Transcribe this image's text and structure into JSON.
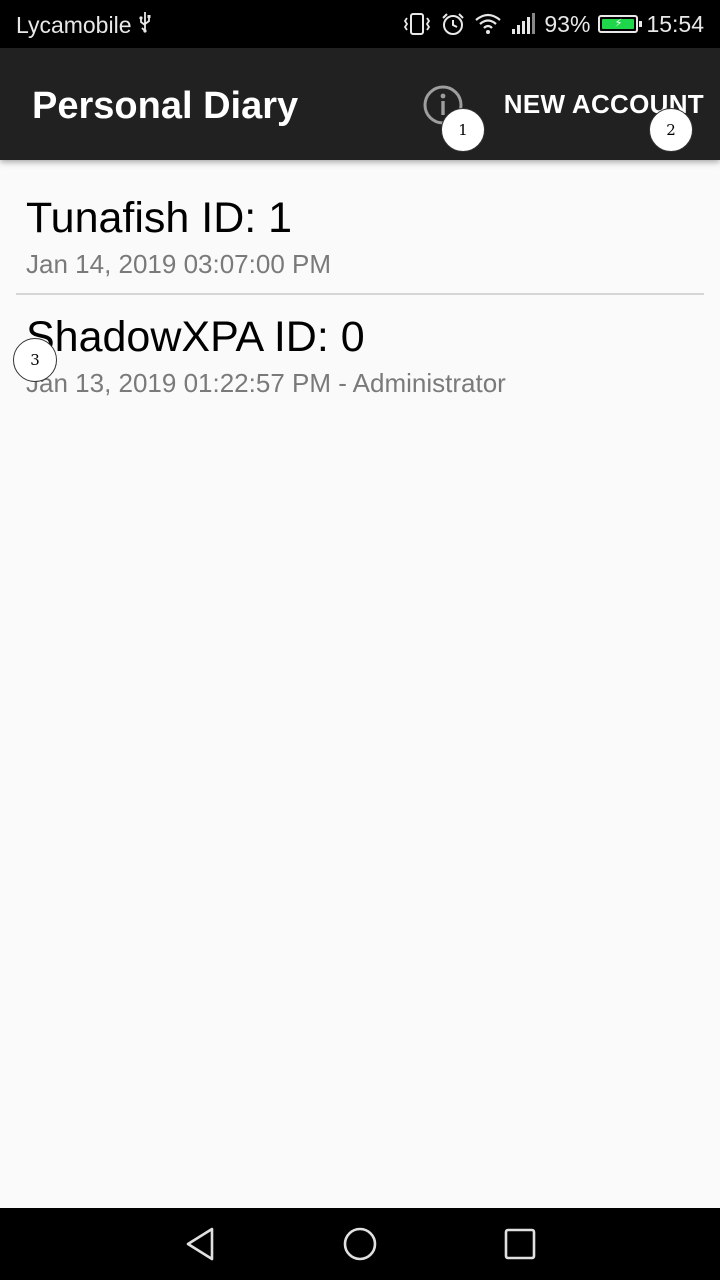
{
  "status_bar": {
    "carrier": "Lycamobile",
    "battery": "93%",
    "time": "15:54",
    "battery_color": "#1fd64b"
  },
  "app_bar": {
    "title": "Personal Diary",
    "info_icon": "info-icon",
    "new_account_label": "NEW ACCOUNT",
    "background": "#212121"
  },
  "accounts": [
    {
      "title": "Tunafish ID: 1",
      "subtitle": "Jan 14, 2019 03:07:00 PM"
    },
    {
      "title": "ShadowXPA ID: 0",
      "subtitle": "Jan 13, 2019 01:22:57 PM - Administrator"
    }
  ],
  "markers": [
    "1",
    "2",
    "3"
  ],
  "nav_bar": {
    "icons": [
      "back-icon",
      "home-icon",
      "recents-icon"
    ]
  }
}
